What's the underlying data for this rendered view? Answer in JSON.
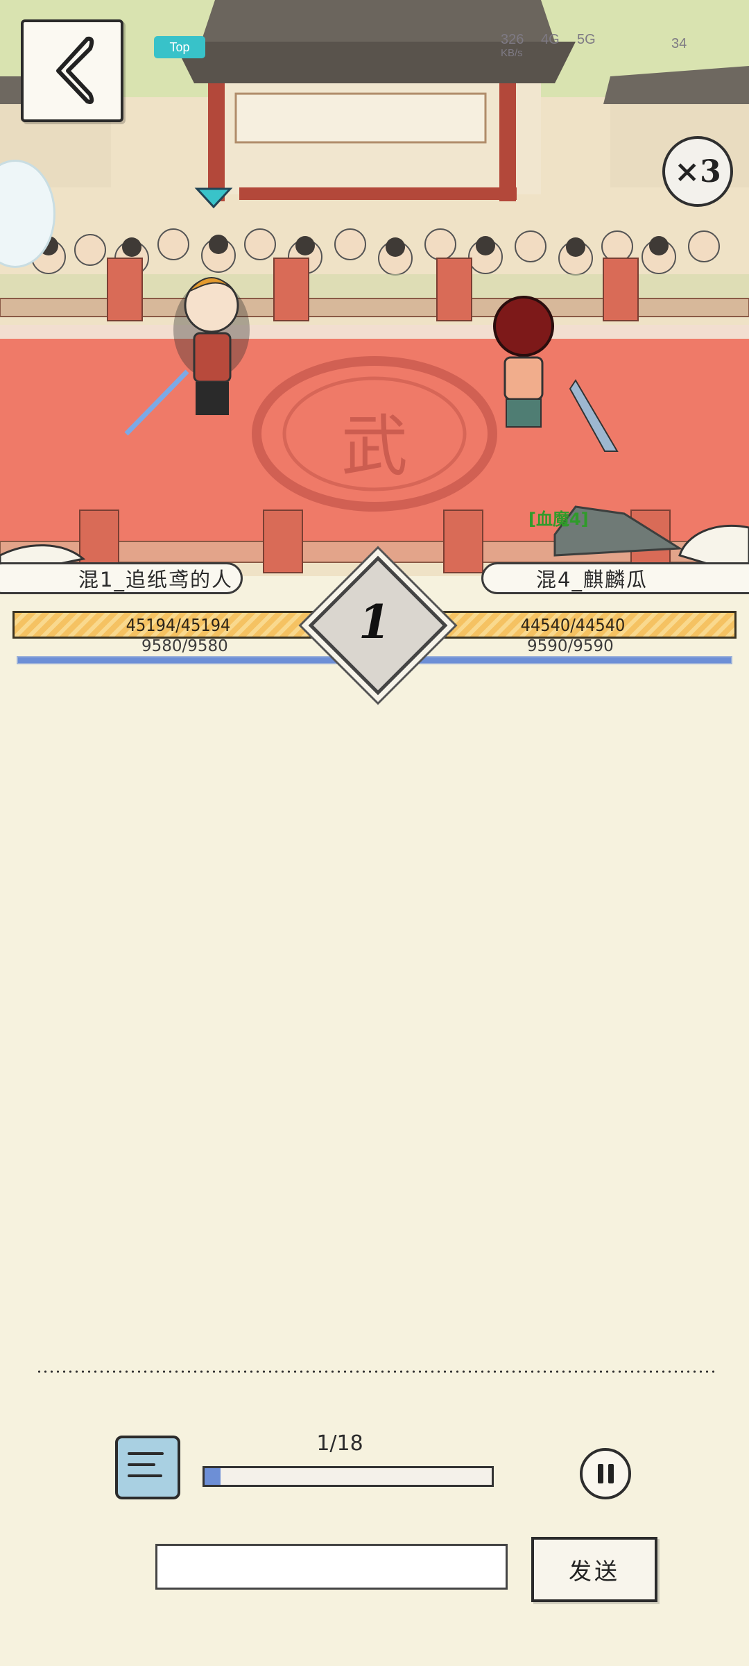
{
  "status_bar": {
    "time": "",
    "net_speed": "326",
    "net_unit": "KB/s",
    "network": "4G",
    "network2": "5G",
    "battery": "34",
    "app_badge": "Top"
  },
  "arena": {
    "emblem": "武",
    "speed_label": "×3",
    "effect_tag": "[血魔4]"
  },
  "turn": {
    "number": "1"
  },
  "player_left": {
    "name": "混1_追纸鸢的人",
    "hp_text": "45194/45194",
    "mp_text": "9580/9580",
    "hp_fraction": 1.0,
    "mp_fraction": 1.0
  },
  "player_right": {
    "name": "混4_麒麟瓜",
    "hp_text": "44540/44540",
    "mp_text": "9590/9590",
    "hp_fraction": 1.0,
    "mp_fraction": 1.0
  },
  "playback": {
    "progress_label": "1/18",
    "progress_fraction": 0.056
  },
  "chat": {
    "input_value": "",
    "input_placeholder": "",
    "send_label": "发送"
  },
  "colors": {
    "arena_floor": "#ef7a68",
    "hp_bar": "#f5c262",
    "mp_bar": "#6d8fd6",
    "panel_bg": "#f6f2de"
  },
  "icons": {
    "back": "back-chevron-icon",
    "chat": "chat-bubble-icon",
    "pause": "pause-icon",
    "side": "side-bubble-icon"
  }
}
